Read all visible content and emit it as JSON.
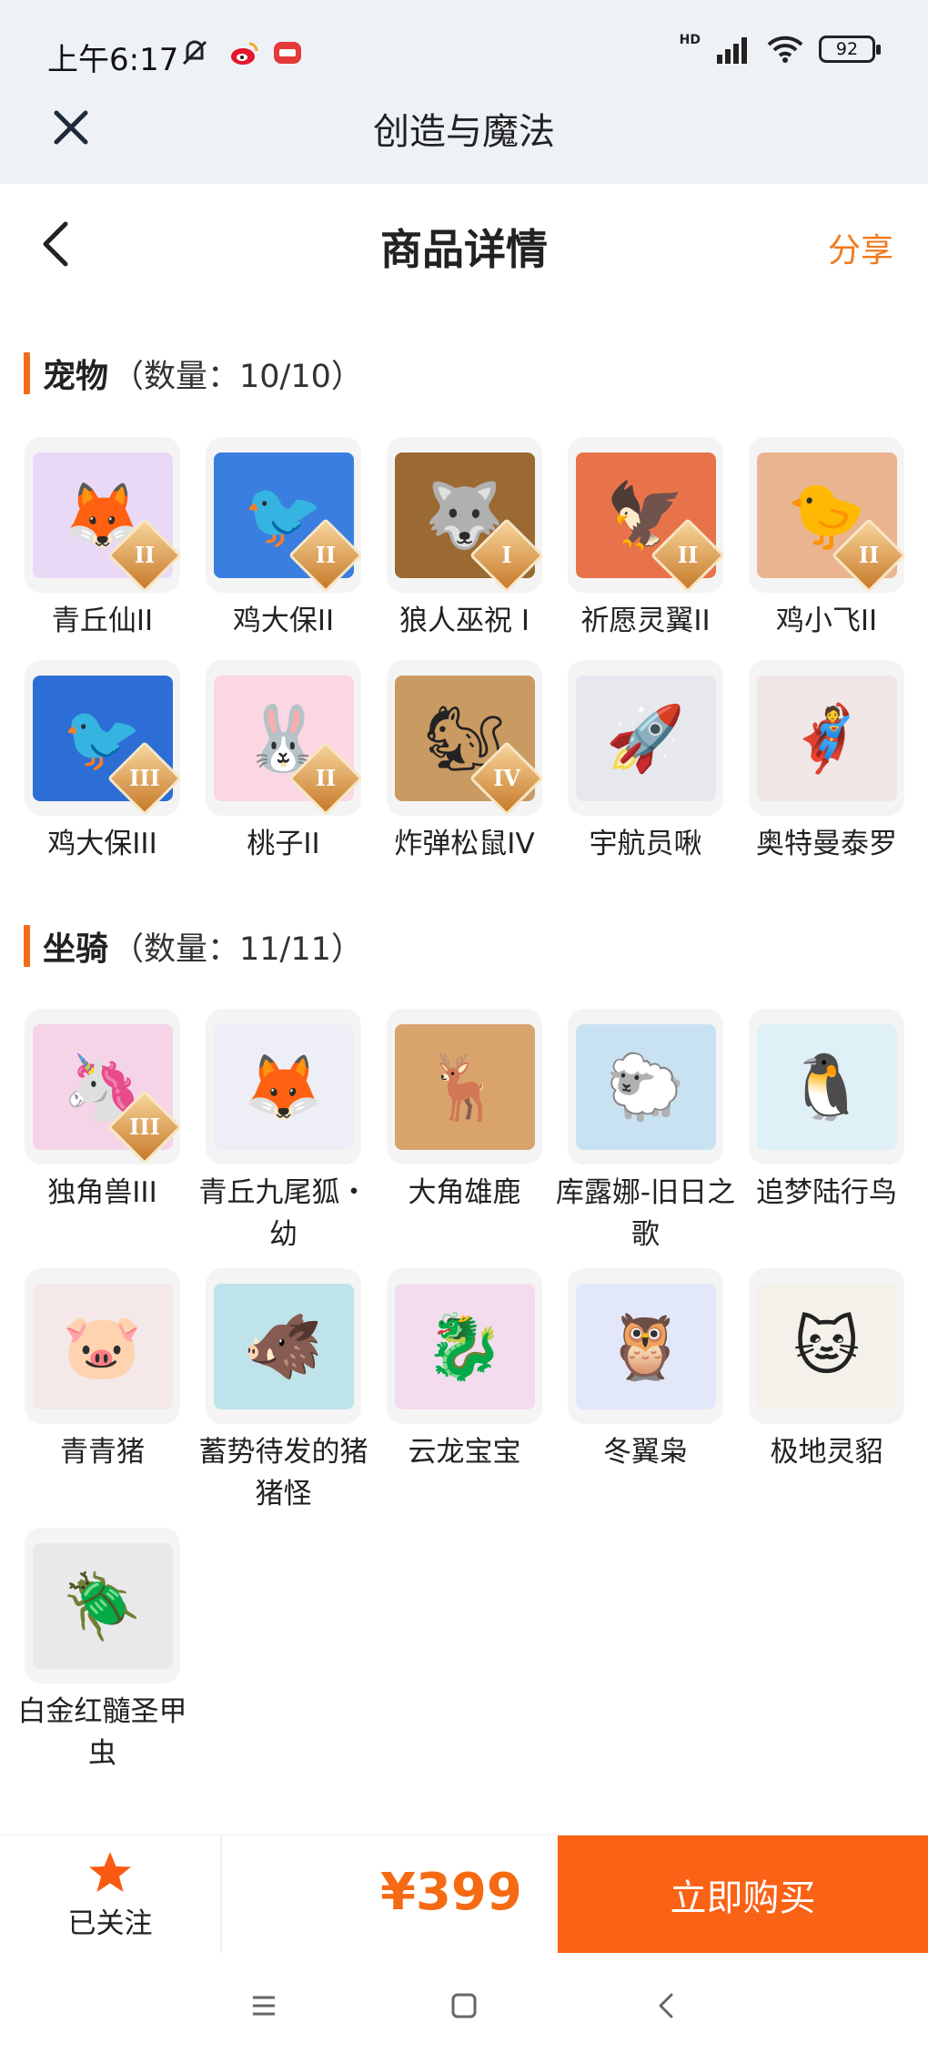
{
  "status": {
    "time": "上午6:17",
    "battery": "92",
    "hd": "HD"
  },
  "webview": {
    "title": "创造与魔法"
  },
  "nav": {
    "title": "商品详情",
    "share": "分享"
  },
  "pets": {
    "name": "宠物",
    "count": "（数量：10/10）",
    "items": [
      {
        "label": "青丘仙II",
        "rank": "II",
        "bg": "#e9d9f6",
        "icon": "fox-fairy-icon",
        "glyph": "🦊"
      },
      {
        "label": "鸡大保II",
        "rank": "II",
        "bg": "#3a7fe0",
        "icon": "blue-bird-icon",
        "glyph": "🐦"
      },
      {
        "label": "狼人巫祝 I",
        "rank": "I",
        "bg": "#9a6a32",
        "icon": "werewolf-icon",
        "glyph": "🐺"
      },
      {
        "label": "祈愿灵翼II",
        "rank": "II",
        "bg": "#e8734a",
        "icon": "eagle-icon",
        "glyph": "🦅"
      },
      {
        "label": "鸡小飞II",
        "rank": "II",
        "bg": "#e9b48f",
        "icon": "chick-icon",
        "glyph": "🐤"
      },
      {
        "label": "鸡大保III",
        "rank": "III",
        "bg": "#2d6ed6",
        "icon": "blue-bird-icon",
        "glyph": "🐦"
      },
      {
        "label": "桃子II",
        "rank": "II",
        "bg": "#fbd6e3",
        "icon": "bunny-icon",
        "glyph": "🐰"
      },
      {
        "label": "炸弹松鼠IV",
        "rank": "IV",
        "bg": "#c99a62",
        "icon": "squirrel-icon",
        "glyph": "🐿"
      },
      {
        "label": "宇航员啾",
        "rank": "",
        "bg": "#e6e8ee",
        "icon": "astronaut-icon",
        "glyph": "🚀"
      },
      {
        "label": "奥特曼泰罗",
        "rank": "",
        "bg": "#f0e6e6",
        "icon": "ultraman-icon",
        "glyph": "🦸"
      }
    ]
  },
  "mounts": {
    "name": "坐骑",
    "count": "（数量：11/11）",
    "items": [
      {
        "label": "独角兽III",
        "rank": "III",
        "bg": "#f4d4e6",
        "icon": "unicorn-icon",
        "glyph": "🦄"
      },
      {
        "label": "青丘九尾狐・幼",
        "rank": "",
        "bg": "#eeeef6",
        "icon": "nine-tail-fox-icon",
        "glyph": "🦊"
      },
      {
        "label": "大角雄鹿",
        "rank": "",
        "bg": "#d9a36c",
        "icon": "deer-icon",
        "glyph": "🦌"
      },
      {
        "label": "库露娜-旧日之歌",
        "rank": "",
        "bg": "#c9e2f2",
        "icon": "sheep-girl-icon",
        "glyph": "🐑"
      },
      {
        "label": "追梦陆行鸟",
        "rank": "",
        "bg": "#dff0f6",
        "icon": "dodo-bird-icon",
        "glyph": "🐧"
      },
      {
        "label": "青青猪",
        "rank": "",
        "bg": "#f4e8e8",
        "icon": "pig-icon",
        "glyph": "🐷"
      },
      {
        "label": "蓄势待发的猪猪怪",
        "rank": "",
        "bg": "#bfe3ea",
        "icon": "black-pig-icon",
        "glyph": "🐗"
      },
      {
        "label": "云龙宝宝",
        "rank": "",
        "bg": "#f2dcee",
        "icon": "baby-dragon-icon",
        "glyph": "🐉"
      },
      {
        "label": "冬翼枭",
        "rank": "",
        "bg": "#e2e8fa",
        "icon": "owl-icon",
        "glyph": "🦉"
      },
      {
        "label": "极地灵貂",
        "rank": "",
        "bg": "#f3f1ea",
        "icon": "snow-mink-icon",
        "glyph": "🐱"
      },
      {
        "label": "白金红髓圣甲虫",
        "rank": "",
        "bg": "#e9e9ec",
        "icon": "beetle-icon",
        "glyph": "🪲"
      }
    ]
  },
  "bottom": {
    "follow_label": "已关注",
    "price": "¥399",
    "buy_label": "立即购买"
  },
  "colors": {
    "accent": "#fa6216",
    "share": "#f07a1d",
    "section_bar": "#f26b1d"
  }
}
